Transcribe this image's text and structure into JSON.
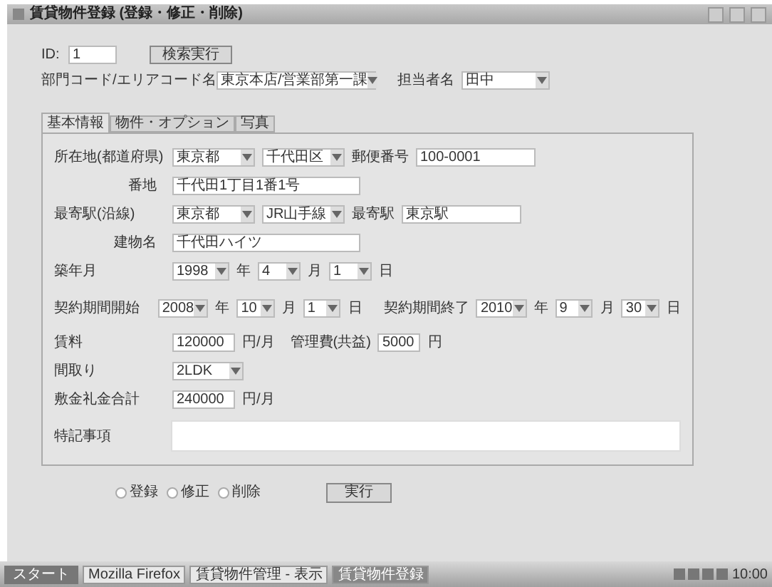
{
  "window": {
    "title": "賃貸物件登録 (登録・修正・削除)"
  },
  "header": {
    "id_label": "ID:",
    "id_value": "1",
    "search_button": "検索実行",
    "area_label": "部門コード/エリアコード名",
    "area_value": "東京本店/営業部第一課",
    "staff_label": "担当者名",
    "staff_value": "田中"
  },
  "tabs": [
    {
      "label": "基本情報",
      "selected": true
    },
    {
      "label": "物件・オプション",
      "selected": false
    },
    {
      "label": "写真",
      "selected": false
    }
  ],
  "address1": {
    "label": "所在地(都道府県)",
    "pref": "東京都",
    "city": "千代田区",
    "zip_label": "郵便番号",
    "zip": "100-0001",
    "street_label": "番地",
    "street": "千代田1丁目1番1号"
  },
  "address2": {
    "label": "最寄駅(沿線)",
    "pref": "東京都",
    "line": "JR山手線",
    "station_label": "最寄駅",
    "station": "東京駅",
    "building_label": "建物名",
    "building": "千代田ハイツ"
  },
  "built": {
    "label": "築年月",
    "year": "1998",
    "year_unit": "年",
    "month": "4",
    "month_unit": "月",
    "day": "1",
    "day_unit": "日"
  },
  "contract": {
    "label": "契約期間開始",
    "year": "2008",
    "year_unit": "年",
    "month": "10",
    "month_unit": "月",
    "day": "1",
    "day_unit": "日",
    "end_label": "契約期間終了",
    "end_year": "2010",
    "end_year_unit": "年",
    "end_month": "9",
    "end_month_unit": "月",
    "end_day": "30",
    "end_day_unit": "日"
  },
  "rent": {
    "label": "賃料",
    "value": "120000",
    "unit": "円/月",
    "fee_label": "管理費(共益)",
    "fee": "5000",
    "fee_unit": "円"
  },
  "layout": {
    "label": "間取り",
    "value": "2LDK"
  },
  "deposit": {
    "label": "敷金礼金合計",
    "value": "240000",
    "unit": "円/月"
  },
  "notes": {
    "label": "特記事項"
  },
  "modes": [
    {
      "label": "登録",
      "selected": false
    },
    {
      "label": "修正",
      "selected": false
    },
    {
      "label": "削除",
      "selected": false
    }
  ],
  "run_button": "実行",
  "taskbar": {
    "start": "スタート",
    "tasks": [
      {
        "label": "Mozilla Firefox",
        "selected": false
      },
      {
        "label": "賃貸物件管理 - 表示",
        "selected": false
      },
      {
        "label": "賃貸物件登録",
        "selected": true
      }
    ],
    "clock": "10:00"
  }
}
